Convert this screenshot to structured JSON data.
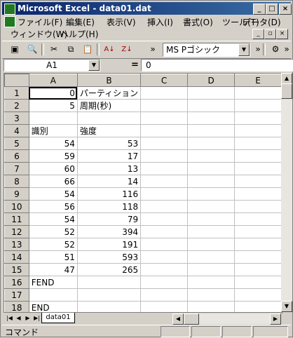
{
  "window": {
    "title": "Microsoft Excel - data01.dat",
    "controls": {
      "minimize": "_",
      "maximize": "□",
      "close": "×"
    }
  },
  "menu": {
    "items": [
      "ファイル(F)",
      "編集(E)",
      "表示(V)",
      "挿入(I)",
      "書式(O)",
      "ツール(T)",
      "データ(D)",
      "ウィンドウ(W)",
      "ヘルプ(H)"
    ]
  },
  "toolbar": {
    "font_name": "MS Pゴシック",
    "icons": [
      "save-icon",
      "print-preview-icon",
      "cut-icon",
      "copy-icon",
      "paste-icon",
      "sort-ascending-icon",
      "sort-descending-icon",
      "more-icon",
      "format-icon"
    ]
  },
  "formula_bar": {
    "name_box": "A1",
    "equals": "=",
    "value": "0"
  },
  "sheet": {
    "columns": [
      "A",
      "B",
      "C",
      "D",
      "E"
    ],
    "rows": [
      {
        "n": "1",
        "a": "0",
        "b": "パーティション"
      },
      {
        "n": "2",
        "a": "5",
        "b": "周期(秒)"
      },
      {
        "n": "3",
        "a": "",
        "b": ""
      },
      {
        "n": "4",
        "a": "識別",
        "b": "強度"
      },
      {
        "n": "5",
        "a": "54",
        "b": "53"
      },
      {
        "n": "6",
        "a": "59",
        "b": "17"
      },
      {
        "n": "7",
        "a": "60",
        "b": "13"
      },
      {
        "n": "8",
        "a": "66",
        "b": "14"
      },
      {
        "n": "9",
        "a": "54",
        "b": "116"
      },
      {
        "n": "10",
        "a": "56",
        "b": "118"
      },
      {
        "n": "11",
        "a": "54",
        "b": "79"
      },
      {
        "n": "12",
        "a": "52",
        "b": "394"
      },
      {
        "n": "13",
        "a": "52",
        "b": "191"
      },
      {
        "n": "14",
        "a": "51",
        "b": "593"
      },
      {
        "n": "15",
        "a": "47",
        "b": "265"
      },
      {
        "n": "16",
        "a": "FEND",
        "b": ""
      },
      {
        "n": "17",
        "a": "",
        "b": ""
      },
      {
        "n": "18",
        "a": "END",
        "b": ""
      }
    ],
    "tab_name": "data01"
  },
  "status": {
    "text": "コマンド"
  }
}
